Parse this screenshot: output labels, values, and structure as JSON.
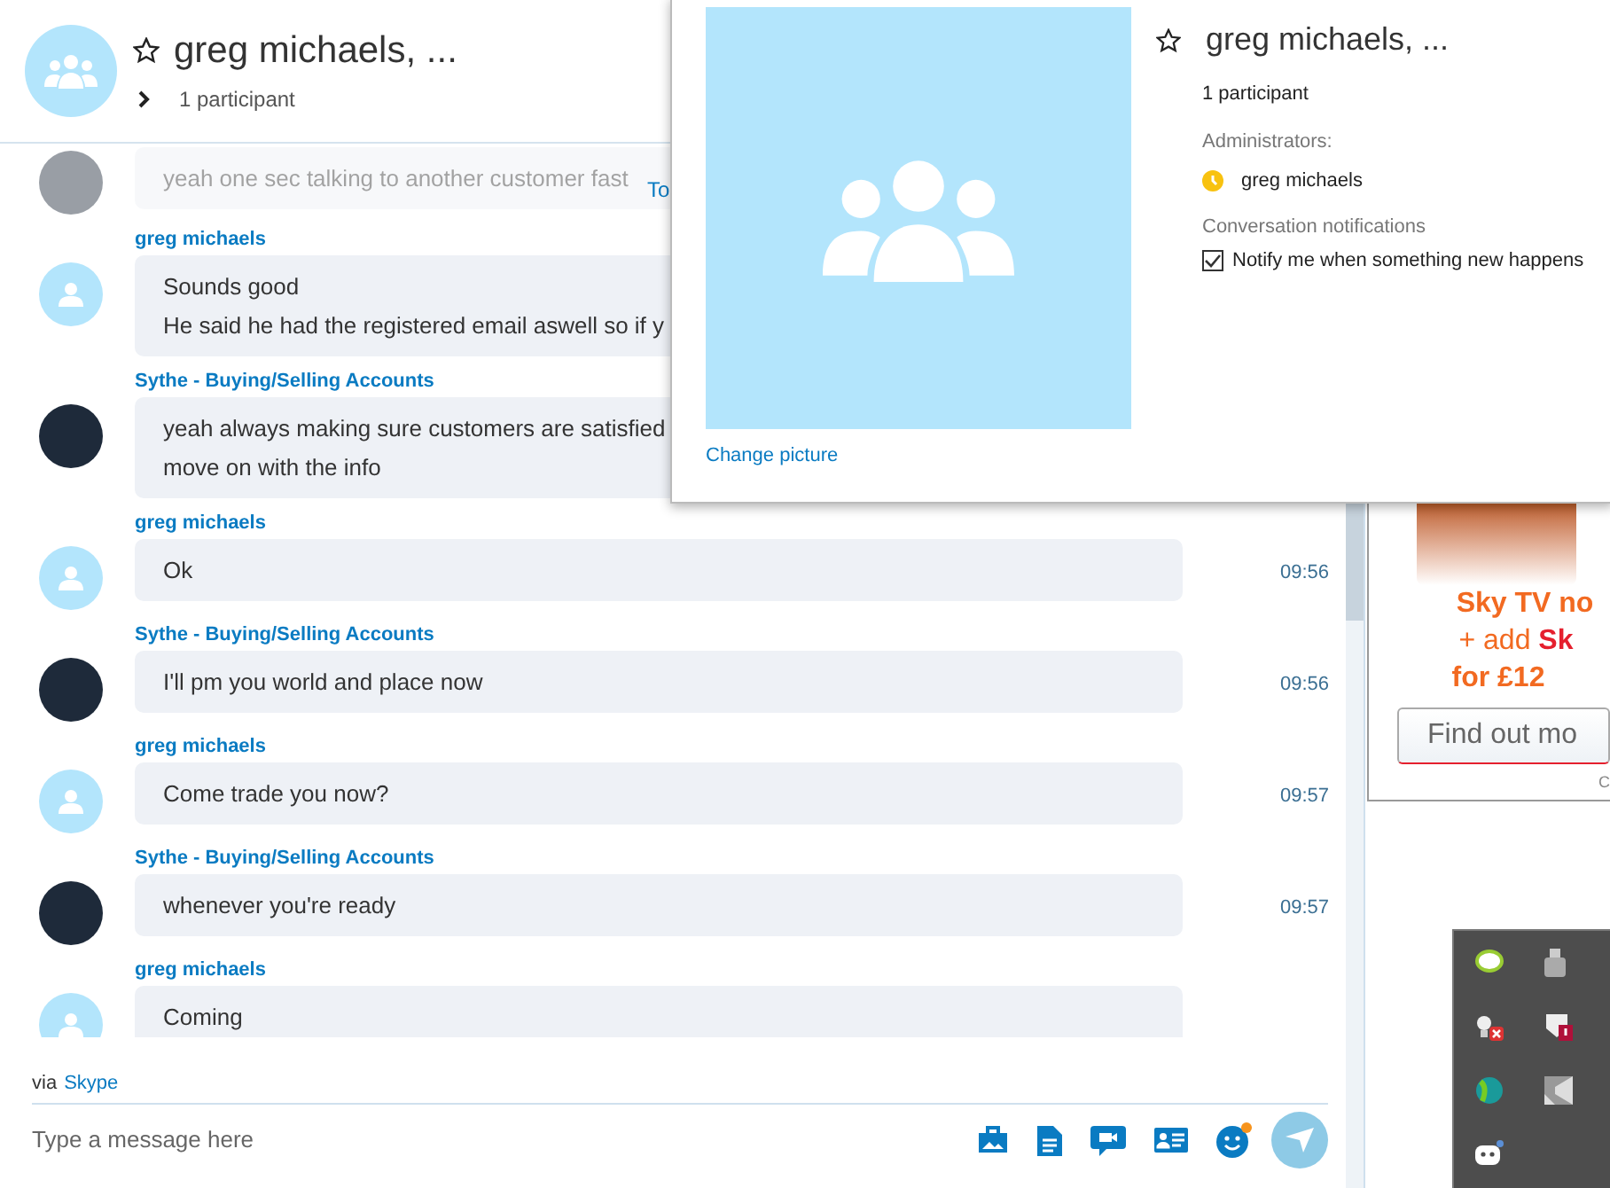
{
  "conversation": {
    "title": "greg michaels, ...",
    "participants": "1 participant",
    "favorite": false,
    "cut_label": "To"
  },
  "messages": [
    {
      "kind": "logo",
      "faded": true,
      "lines": [
        "yeah one sec talking to another customer fast"
      ]
    },
    {
      "sender": "greg michaels",
      "kind": "person",
      "faded": false,
      "lines": [
        "Sounds good",
        "He said he had the registered email aswell so if y"
      ]
    },
    {
      "sender": "Sythe - Buying/Selling Accounts",
      "kind": "logo",
      "faded": false,
      "lines": [
        "yeah always making sure customers are satisfied",
        "move on with the info"
      ]
    },
    {
      "sender": "greg michaels",
      "kind": "person",
      "faded": false,
      "lines": [
        "Ok"
      ],
      "time": "09:56"
    },
    {
      "sender": "Sythe - Buying/Selling Accounts",
      "kind": "logo",
      "faded": false,
      "lines": [
        "I'll pm you world and place now"
      ],
      "time": "09:56"
    },
    {
      "sender": "greg michaels",
      "kind": "person",
      "faded": false,
      "lines": [
        "Come trade you now?"
      ],
      "time": "09:57"
    },
    {
      "sender": "Sythe - Buying/Selling Accounts",
      "kind": "logo",
      "faded": false,
      "lines": [
        "whenever you're ready"
      ],
      "time": "09:57"
    },
    {
      "sender": "greg michaels",
      "kind": "person",
      "faded": false,
      "lines": [
        "Coming"
      ]
    }
  ],
  "footer": {
    "via": "via",
    "via_link": "Skype",
    "placeholder": "Type a message here"
  },
  "ad": {
    "lines": [
      "Sky TV no",
      "+ add **Sk**",
      "for £12"
    ],
    "button": "Find out mo",
    "small": "C"
  },
  "popup": {
    "title": "greg michaels, ...",
    "favorite": false,
    "participants": "1 participant",
    "admins_label": "Administrators:",
    "admins": [
      {
        "name": "greg michaels"
      }
    ],
    "notifications_label": "Conversation notifications",
    "notify": {
      "label": "Notify me when something new happens",
      "checked": true
    },
    "change_picture": "Change picture"
  }
}
